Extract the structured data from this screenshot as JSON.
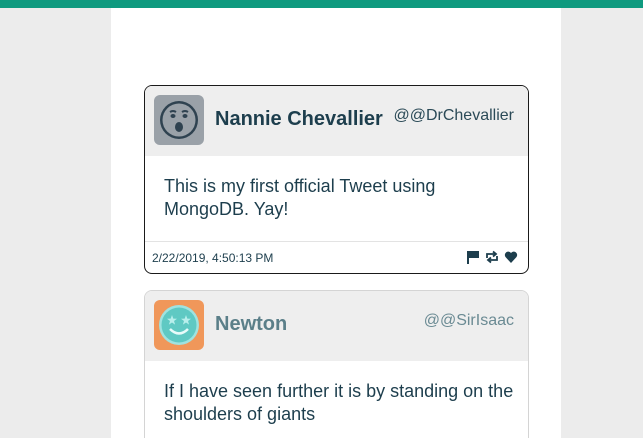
{
  "colors": {
    "accent": "#0f9a7f",
    "text_primary": "#1d3e4d",
    "header_bg": "#eeeeee"
  },
  "tweets": [
    {
      "display_name": "Nannie Chevallier",
      "handle": "@@DrChevallier",
      "text": "This is my first official Tweet using MongoDB. Yay!",
      "timestamp": "2/22/2019, 4:50:13 PM",
      "avatar_icon": "shocked-face-icon",
      "actions": [
        "flag-icon",
        "retweet-icon",
        "heart-icon"
      ]
    },
    {
      "display_name": "Newton",
      "handle": "@@SirIsaac",
      "text": "If I have seen further it is by standing on the shoulders of giants",
      "avatar_icon": "star-eyed-face-icon"
    }
  ]
}
